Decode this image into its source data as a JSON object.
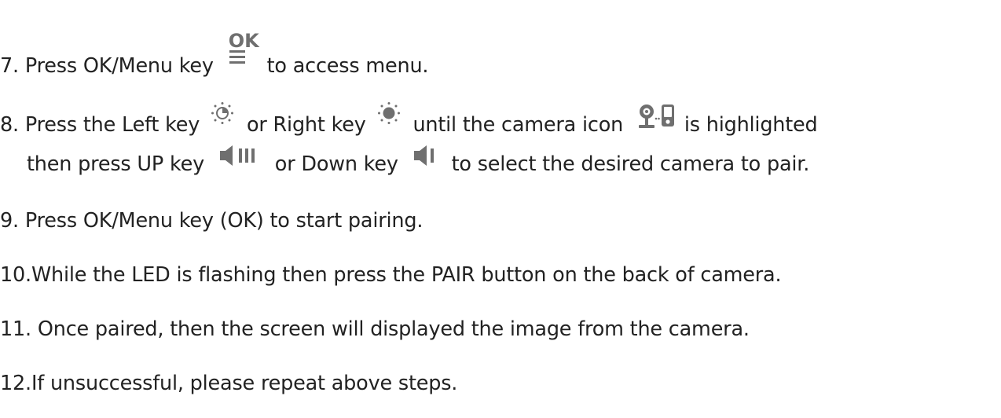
{
  "steps": [
    {
      "number": "7.",
      "parts": [
        "Press OK/Menu key",
        "to access menu."
      ]
    },
    {
      "number": "8.",
      "parts": [
        "Press the Left key",
        "or Right key",
        "until the camera icon",
        "is highlighted"
      ],
      "continuation_parts": [
        "then press UP key",
        "or Down key",
        "to select the desired camera to pair."
      ]
    },
    {
      "number": "9.",
      "text": "Press OK/Menu key (OK) to start pairing."
    },
    {
      "number": "10.",
      "text": "While the LED is flashing then press the PAIR button on the back of camera."
    },
    {
      "number": "11.",
      "text": "Once paired, then the screen will displayed the image from the camera."
    },
    {
      "number": "12.",
      "text": "If unsuccessful, please repeat above steps."
    }
  ],
  "icons": {
    "ok_menu": {
      "name": "ok-menu-icon",
      "label": "OK"
    },
    "left_key": {
      "name": "brightness-low-icon"
    },
    "right_key": {
      "name": "brightness-high-icon"
    },
    "camera": {
      "name": "camera-monitor-icon"
    },
    "up_key": {
      "name": "volume-up-icon"
    },
    "down_key": {
      "name": "volume-down-icon"
    }
  },
  "colors": {
    "text": "#222222",
    "icon_gray": "#6f6f6f"
  }
}
